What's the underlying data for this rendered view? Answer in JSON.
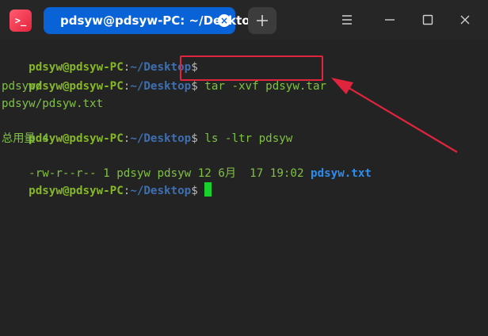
{
  "titlebar": {
    "app_icon_text": ">_",
    "tab_title": "pdsyw@pdsyw-PC: ~/Desktop",
    "new_tab_icon": "plus-icon",
    "menu_icon": "hamburger-menu-icon",
    "minimize_icon": "minimize-icon",
    "maximize_icon": "maximize-icon",
    "close_icon": "close-icon"
  },
  "terminal": {
    "prompt_user": "pdsyw@pdsyw-PC",
    "prompt_colon": ":",
    "prompt_path": "~/Desktop",
    "prompt_dollar": "$",
    "lines": [
      {
        "type": "prompt",
        "command": ""
      },
      {
        "type": "prompt",
        "command": " tar -xvf pdsyw.tar"
      },
      {
        "type": "output",
        "text": "pdsyw/"
      },
      {
        "type": "output",
        "text": "pdsyw/pdsyw.txt"
      },
      {
        "type": "prompt",
        "command": " ls -ltr pdsyw"
      },
      {
        "type": "output",
        "text": "总用量 4"
      },
      {
        "type": "listing",
        "text": "-rw-r--r-- 1 pdsyw pdsyw 12 6月  17 19:02 ",
        "file": "pdsyw.txt"
      },
      {
        "type": "prompt",
        "command": " ",
        "cursor": true
      }
    ]
  },
  "annotation": {
    "highlight_color": "#e0243e",
    "arrow_color": "#e0243e"
  }
}
